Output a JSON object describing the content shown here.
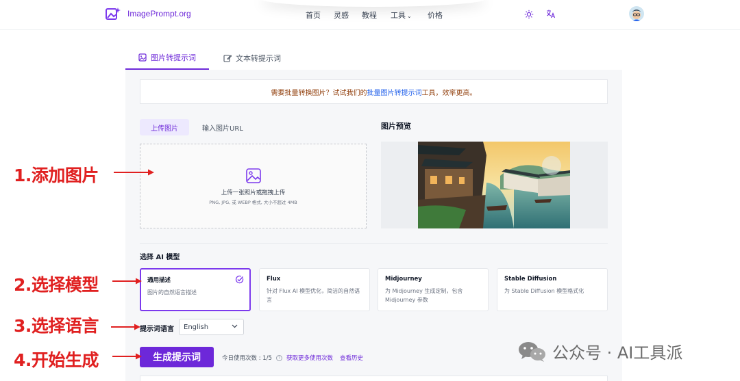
{
  "header": {
    "logo_text": "ImagePrompt.org",
    "nav": [
      "首页",
      "灵感",
      "教程",
      "工具",
      "价格"
    ],
    "tools_chevron": "⌄"
  },
  "tabs": {
    "image_to_prompt": "图片转提示词",
    "text_to_prompt": "文本转提示词"
  },
  "notice": {
    "prefix": "需要批量转换图片？试试我们的",
    "link": "批量图片转提示词",
    "suffix": "工具，效率更高。"
  },
  "upload": {
    "tab_upload": "上传图片",
    "tab_url": "输入图片URL",
    "title": "上传一张照片或拖拽上传",
    "hint": "PNG, JPG, 或 WEBP 格式, 大小不超过 4MB"
  },
  "preview": {
    "title": "图片预览"
  },
  "models": {
    "section_label": "选择 AI 模型",
    "items": [
      {
        "name": "通用描述",
        "desc": "图片的自然语言描述",
        "selected": true
      },
      {
        "name": "Flux",
        "desc": "针对 Flux AI 模型优化，简洁的自然语言",
        "selected": false
      },
      {
        "name": "Midjourney",
        "desc": "为 Midjourney 生成定制，包含 Midjourney 参数",
        "selected": false
      },
      {
        "name": "Stable Diffusion",
        "desc": "为 Stable Diffusion 模型格式化",
        "selected": false
      }
    ]
  },
  "language": {
    "label": "提示词语言",
    "value": "English"
  },
  "generate": {
    "button": "生成提示词",
    "usage": "今日使用次数 : 1/5",
    "info": "?",
    "more_link": "获取更多使用次数",
    "history_link": "查看历史"
  },
  "annotations": {
    "step1": "1.添加图片",
    "step2": "2.选择模型",
    "step3": "3.选择语言",
    "step4": "4.开始生成"
  },
  "watermark": {
    "text": "公众号 · AI工具派"
  },
  "colors": {
    "accent": "#6d28d9",
    "annotation_red": "#e02020",
    "notice_text": "#92400e"
  }
}
